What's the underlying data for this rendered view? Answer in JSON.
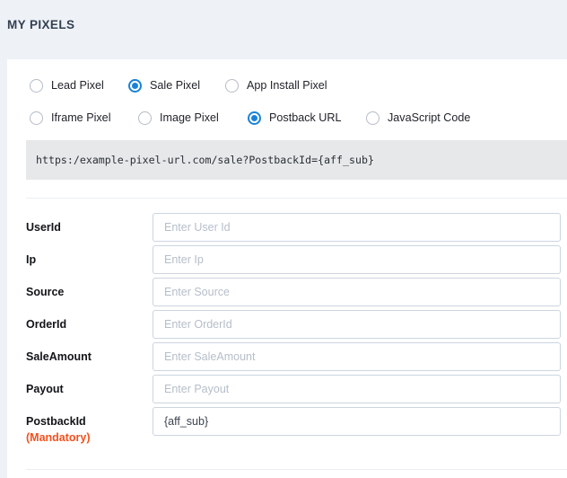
{
  "header": {
    "title": "MY PIXELS"
  },
  "colors": {
    "page_background": "#eef2f6",
    "card_background": "#ffffff",
    "radio_selected": "#1a82d8",
    "mandatory_text": "#f4511e",
    "url_block_background": "#e6e8ea",
    "input_border": "#ccd5e0",
    "placeholder": "#b6bec9"
  },
  "pixel_type_group": {
    "name": "pixel-type",
    "options": [
      {
        "label": "Lead Pixel",
        "selected": false
      },
      {
        "label": "Sale Pixel",
        "selected": true
      },
      {
        "label": "App Install Pixel",
        "selected": false
      }
    ]
  },
  "delivery_method_group": {
    "name": "delivery-method",
    "options": [
      {
        "label": "Iframe Pixel",
        "selected": false
      },
      {
        "label": "Image Pixel",
        "selected": false
      },
      {
        "label": "Postback URL",
        "selected": true
      },
      {
        "label": "JavaScript Code",
        "selected": false
      }
    ]
  },
  "url_preview": {
    "value": "https:/example-pixel-url.com/sale?PostbackId={aff_sub}"
  },
  "form": {
    "fields": [
      {
        "label": "UserId",
        "placeholder": "Enter User Id",
        "value": ""
      },
      {
        "label": "Ip",
        "placeholder": "Enter Ip",
        "value": ""
      },
      {
        "label": "Source",
        "placeholder": "Enter Source",
        "value": ""
      },
      {
        "label": "OrderId",
        "placeholder": "Enter OrderId",
        "value": ""
      },
      {
        "label": "SaleAmount",
        "placeholder": "Enter SaleAmount",
        "value": ""
      },
      {
        "label": "Payout",
        "placeholder": "Enter Payout",
        "value": ""
      },
      {
        "label": "PostbackId",
        "placeholder": "",
        "value": "{aff_sub}",
        "note": "(Mandatory)"
      }
    ]
  }
}
